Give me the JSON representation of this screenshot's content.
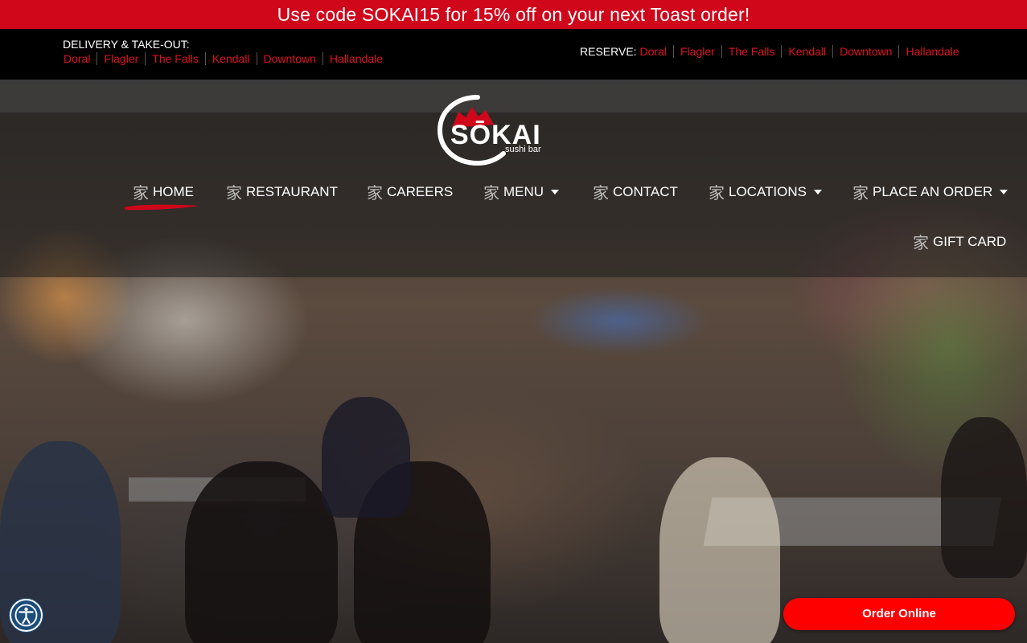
{
  "promo": {
    "text": "Use code SOKAI15 for 15% off on your next Toast order!"
  },
  "delivery": {
    "title": "DELIVERY & TAKE-OUT:",
    "locations": [
      "Doral",
      "Flagler",
      "The Falls",
      "Kendall",
      "Downtown",
      "Hallandale"
    ]
  },
  "reserve": {
    "title": "RESERVE:",
    "locations": [
      "Doral",
      "Flagler",
      "The Falls",
      "Kendall",
      "Downtown",
      "Hallandale"
    ]
  },
  "logo": {
    "brand": "SŌKAI",
    "tagline": "sushi bar"
  },
  "nav": {
    "kanji": "家",
    "items": [
      {
        "label": "HOME",
        "has_dropdown": false,
        "active": true
      },
      {
        "label": "RESTAURANT",
        "has_dropdown": false
      },
      {
        "label": "CAREERS",
        "has_dropdown": false
      },
      {
        "label": "MENU",
        "has_dropdown": true
      },
      {
        "label": "CONTACT",
        "has_dropdown": false
      },
      {
        "label": "LOCATIONS",
        "has_dropdown": true
      },
      {
        "label": "PLACE AN ORDER",
        "has_dropdown": true
      },
      {
        "label": "GIFT CARD",
        "has_dropdown": false
      }
    ]
  },
  "order_online": {
    "label": "Order Online"
  },
  "colors": {
    "brand_red": "#d0061b",
    "link_red": "#e0101f",
    "button_red": "#ff0000",
    "a11y_blue": "#1d4d7a"
  }
}
